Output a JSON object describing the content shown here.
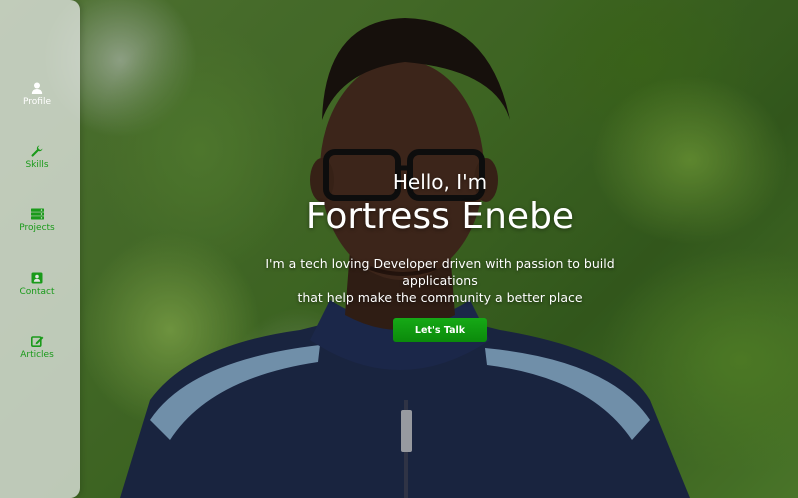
{
  "sidebar": {
    "items": [
      {
        "label": "Profile",
        "icon": "user-icon",
        "active": true
      },
      {
        "label": "Skills",
        "icon": "wrench-icon",
        "active": false
      },
      {
        "label": "Projects",
        "icon": "projects-icon",
        "active": false
      },
      {
        "label": "Contact",
        "icon": "contact-icon",
        "active": false
      },
      {
        "label": "Articles",
        "icon": "edit-icon",
        "active": false
      }
    ]
  },
  "hero": {
    "greeting": "Hello, I'm",
    "name": "Fortress Enebe",
    "tagline_line1": "I'm a tech loving Developer driven with passion to build applications",
    "tagline_line2": "that help make the community a better place",
    "cta_label": "Let's Talk"
  },
  "colors": {
    "accent": "#0f9a0f",
    "nav_text": "#1a9a1a",
    "active_text": "#ffffff"
  }
}
